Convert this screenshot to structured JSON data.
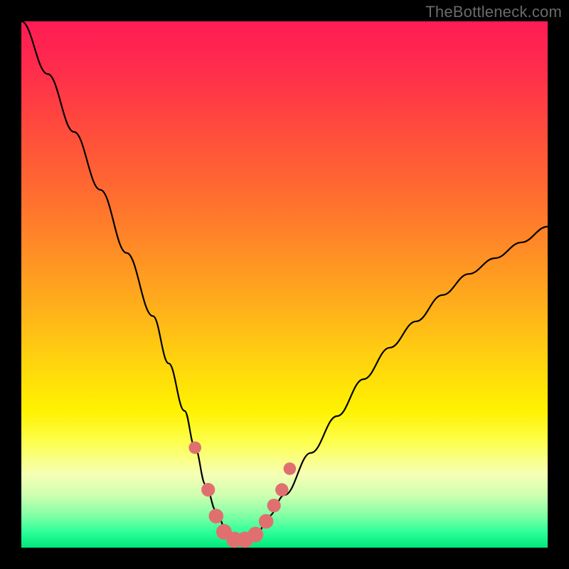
{
  "watermark": "TheBottleneck.com",
  "chart_data": {
    "type": "line",
    "title": "",
    "xlabel": "",
    "ylabel": "",
    "xlim": [
      0,
      100
    ],
    "ylim": [
      0,
      100
    ],
    "grid": false,
    "background_gradient": [
      "#ff1c55",
      "#ff8e25",
      "#fff200",
      "#00e77d"
    ],
    "series": [
      {
        "name": "bottleneck-curve",
        "color": "#000000",
        "x": [
          0,
          5,
          10,
          15,
          20,
          25,
          28,
          31,
          33,
          35,
          37,
          39,
          41,
          43,
          45,
          47,
          50,
          55,
          60,
          65,
          70,
          75,
          80,
          85,
          90,
          95,
          100
        ],
        "values": [
          100,
          90,
          79,
          68,
          56,
          44,
          35,
          26,
          19,
          12,
          7,
          3,
          1,
          1,
          3,
          6,
          10,
          18,
          25,
          32,
          38,
          43,
          48,
          52,
          55,
          58,
          61
        ]
      }
    ],
    "markers": [
      {
        "name": "point-a",
        "x": 33.0,
        "y": 19.0,
        "r": 1.3,
        "color": "#e07070"
      },
      {
        "name": "point-b",
        "x": 35.5,
        "y": 11.0,
        "r": 1.5,
        "color": "#e07070"
      },
      {
        "name": "point-c",
        "x": 37.0,
        "y": 6.0,
        "r": 1.7,
        "color": "#e07070"
      },
      {
        "name": "point-d",
        "x": 38.5,
        "y": 3.0,
        "r": 1.9,
        "color": "#e07070"
      },
      {
        "name": "point-e",
        "x": 40.5,
        "y": 1.5,
        "r": 2.0,
        "color": "#e07070"
      },
      {
        "name": "point-f",
        "x": 42.5,
        "y": 1.5,
        "r": 2.0,
        "color": "#e07070"
      },
      {
        "name": "point-g",
        "x": 44.5,
        "y": 2.5,
        "r": 1.9,
        "color": "#e07070"
      },
      {
        "name": "point-h",
        "x": 46.5,
        "y": 5.0,
        "r": 1.7,
        "color": "#e07070"
      },
      {
        "name": "point-i",
        "x": 48.0,
        "y": 8.0,
        "r": 1.5,
        "color": "#e07070"
      },
      {
        "name": "point-j",
        "x": 49.5,
        "y": 11.0,
        "r": 1.4,
        "color": "#e07070"
      },
      {
        "name": "point-k",
        "x": 51.0,
        "y": 15.0,
        "r": 1.3,
        "color": "#e07070"
      }
    ]
  }
}
